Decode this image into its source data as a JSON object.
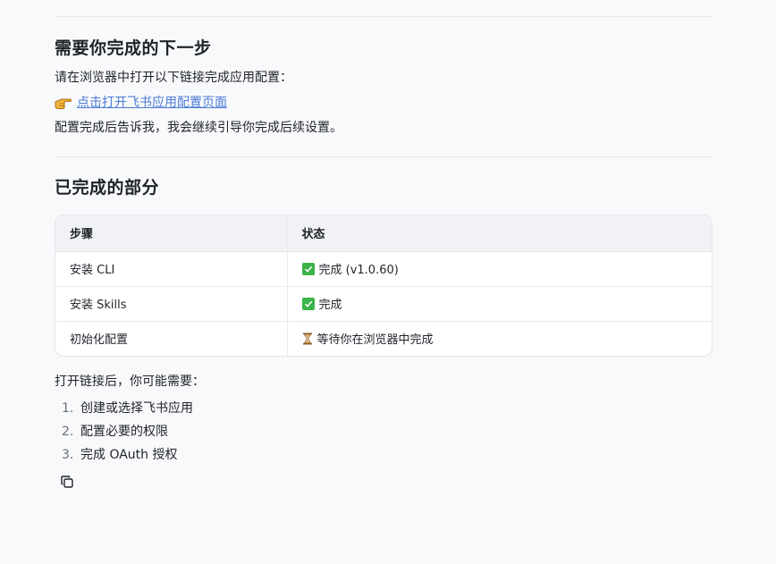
{
  "next_step": {
    "heading": "需要你完成的下一步",
    "instruction": "请在浏览器中打开以下链接完成应用配置：",
    "link_icon": "pointing-hand-icon",
    "link_text": "点击打开飞书应用配置页面",
    "after_text": "配置完成后告诉我，我会继续引导你完成后续设置。"
  },
  "done": {
    "heading": "已完成的部分",
    "table": {
      "headers": [
        "步骤",
        "状态"
      ],
      "rows": [
        {
          "step": "安装 CLI",
          "status_icon": "check-icon",
          "status": "完成 (v1.0.60)"
        },
        {
          "step": "安装 Skills",
          "status_icon": "check-icon",
          "status": "完成"
        },
        {
          "step": "初始化配置",
          "status_icon": "hourglass-icon",
          "status": "等待你在浏览器中完成"
        }
      ]
    }
  },
  "followup": {
    "intro": "打开链接后，你可能需要：",
    "items": [
      {
        "num": "1.",
        "text": "创建或选择飞书应用"
      },
      {
        "num": "2.",
        "text": "配置必要的权限"
      },
      {
        "num": "3.",
        "text": "完成 OAuth 授权"
      }
    ]
  },
  "colors": {
    "link": "#4b7bd6",
    "check": "#3bb34a",
    "background": "#f8f9fb"
  },
  "copy_icon": "copy-icon"
}
